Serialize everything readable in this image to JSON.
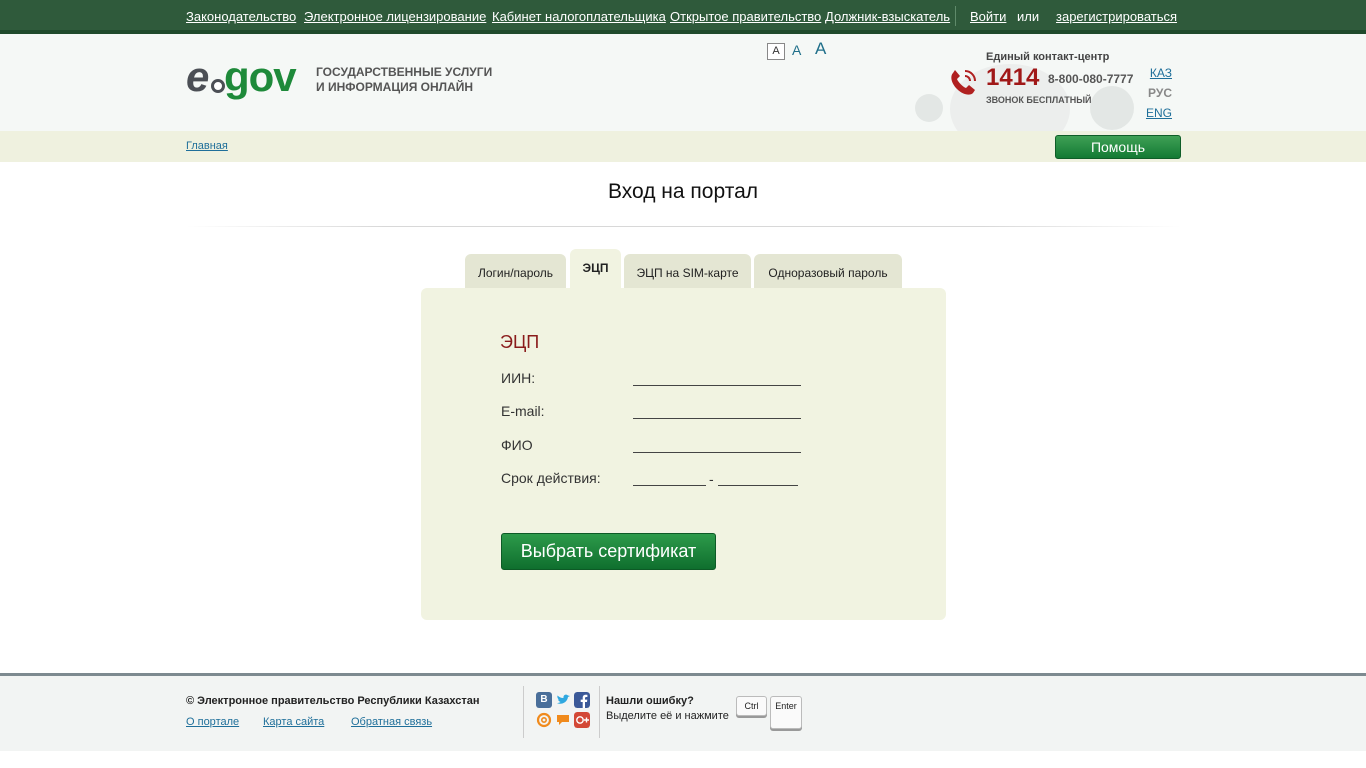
{
  "topnav": {
    "links": [
      "Законодательство",
      "Электронное лицензирование",
      "Кабинет налогоплательщика",
      "Открытое правительство",
      "Должник-взыскатель"
    ],
    "login": "Войти",
    "or": "или",
    "register": "зарегистрироваться"
  },
  "header": {
    "logo_e": "e",
    "logo_gov": "gov",
    "slogan_line1": "ГОСУДАРСТВЕННЫЕ УСЛУГИ",
    "slogan_line2": "И ИНФОРМАЦИЯ ОНЛАЙН",
    "font_small": "A",
    "font_medium": "A",
    "font_large": "A",
    "contact_title": "Единый контакт-центр",
    "contact_number": "1414",
    "contact_alt": "8-800-080-7777",
    "contact_free": "ЗВОНОК БЕСПЛАТНЫЙ",
    "languages": [
      "КАЗ",
      "РУС",
      "ENG"
    ]
  },
  "breadcrumb": {
    "home": "Главная"
  },
  "help_button": "Помощь",
  "page_title": "Вход на портал",
  "tabs": [
    "Логин/пароль",
    "ЭЦП",
    "ЭЦП на SIM-карте",
    "Одноразовый пароль"
  ],
  "form": {
    "title": "ЭЦП",
    "iin_label": "ИИН:",
    "email_label": "E-mail:",
    "fio_label": "ФИО",
    "validity_label": "Срок действия:",
    "validity_separator": "-",
    "select_button": "Выбрать сертификат"
  },
  "footer": {
    "copyright": "© Электронное правительство Республики Казахстан",
    "links": [
      "О портале",
      "Карта сайта",
      "Обратная связь"
    ],
    "social": [
      "В"
    ],
    "error_title": "Нашли ошибку?",
    "error_text": "Выделите её и нажмите",
    "key_ctrl": "Ctrl",
    "key_enter": "Enter"
  },
  "colors": {
    "topbar": "#2f5a3b",
    "brand_green": "#1e8a3a",
    "accent_red": "#a01818",
    "panel_bg": "#f1f3e1"
  }
}
